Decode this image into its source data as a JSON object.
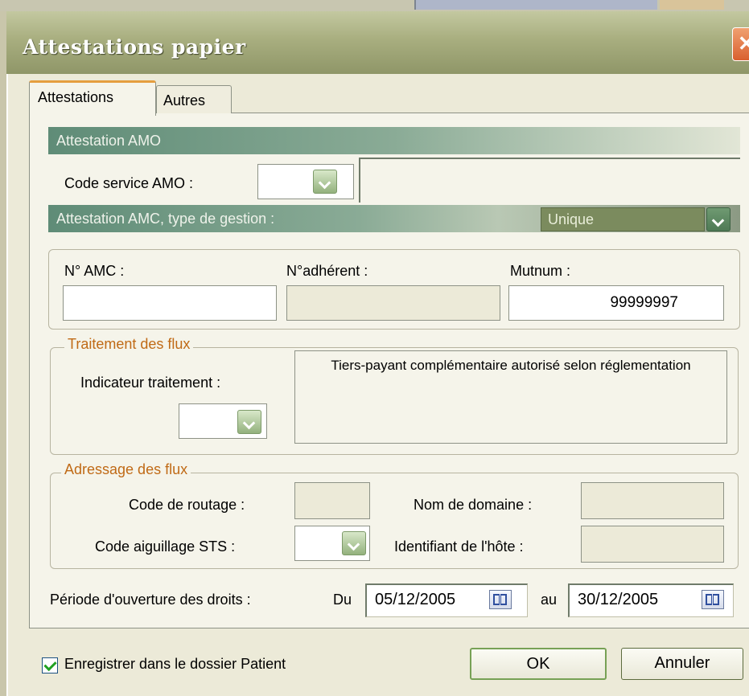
{
  "window": {
    "title": "Attestations papier"
  },
  "tabs": [
    {
      "label": "Attestations",
      "active": true
    },
    {
      "label": "Autres",
      "active": false
    }
  ],
  "amo": {
    "header": "Attestation AMO",
    "code_service_label": "Code service AMO :",
    "code_service_value": "",
    "service_description": ""
  },
  "amc": {
    "header": "Attestation AMC, type de gestion :",
    "type_gestion": "Unique",
    "num_amc_label": "N° AMC :",
    "num_amc_value": "",
    "num_adherent_label": "N°adhérent :",
    "num_adherent_value": "",
    "mutnum_label": "Mutnum :",
    "mutnum_value": "99999997"
  },
  "traitement": {
    "legend": "Traitement des flux",
    "indicateur_label": "Indicateur traitement :",
    "indicateur_value": "",
    "description": "Tiers-payant complémentaire autorisé selon réglementation"
  },
  "adressage": {
    "legend": "Adressage des flux",
    "code_routage_label": "Code de routage :",
    "code_routage_value": "",
    "nom_domaine_label": "Nom de domaine :",
    "nom_domaine_value": "",
    "code_aiguillage_label": "Code aiguillage STS :",
    "code_aiguillage_value": "",
    "identifiant_hote_label": "Identifiant de l'hôte :",
    "identifiant_hote_value": ""
  },
  "periode": {
    "label": "Période d'ouverture des droits :",
    "du_label": "Du",
    "du_value": "05/12/2005",
    "au_label": "au",
    "au_value": "30/12/2005"
  },
  "footer": {
    "checkbox_label": "Enregistrer dans le dossier Patient",
    "checkbox_checked": true,
    "ok_label": "OK",
    "cancel_label": "Annuler"
  },
  "colors": {
    "header_band": "#5f8c77",
    "legend_text": "#c06a16",
    "window_bg": "#ecead8",
    "accent_tab": "#e59e3f"
  }
}
